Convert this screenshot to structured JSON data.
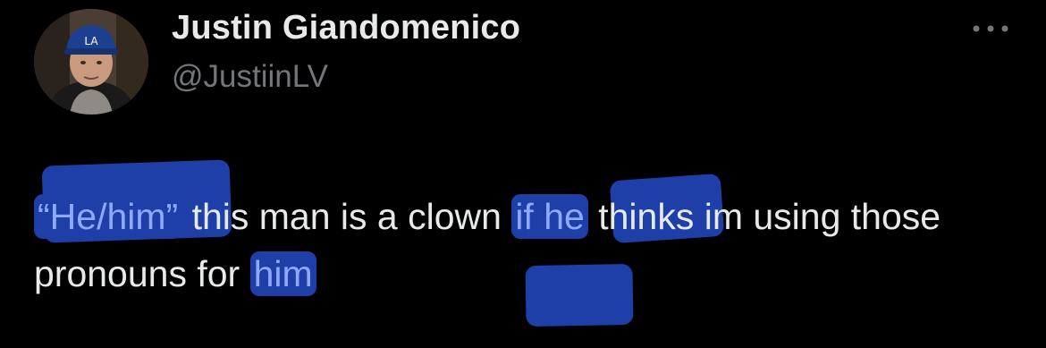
{
  "user": {
    "display_name": "Justin Giandomenico",
    "handle": "@JustiinLV"
  },
  "menu": {
    "icon": "more-horizontal-icon"
  },
  "tweet": {
    "text_parts": [
      "“He/him”",
      " this man is a clown ",
      "if he",
      " thinks im using those pronouns for ",
      "him"
    ]
  },
  "colors": {
    "background": "#000000",
    "text": "#e7e9ea",
    "handle": "#71767b",
    "highlight": "#1f3fa8",
    "highlight_text": "#8ea9ff"
  }
}
